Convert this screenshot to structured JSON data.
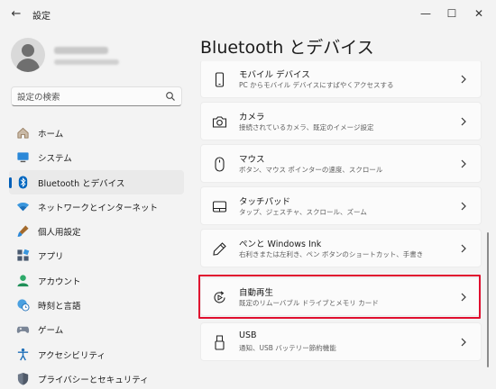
{
  "window": {
    "title": "設定",
    "back_glyph": "←",
    "minimize_glyph": "—",
    "maximize_glyph": "☐",
    "close_glyph": "✕"
  },
  "search": {
    "placeholder": "設定の検索"
  },
  "nav": {
    "items": [
      {
        "label": "ホーム",
        "icon": "home-icon"
      },
      {
        "label": "システム",
        "icon": "monitor-icon"
      },
      {
        "label": "Bluetooth とデバイス",
        "icon": "bluetooth-icon",
        "active": true
      },
      {
        "label": "ネットワークとインターネット",
        "icon": "wifi-icon"
      },
      {
        "label": "個人用設定",
        "icon": "brush-icon"
      },
      {
        "label": "アプリ",
        "icon": "apps-icon"
      },
      {
        "label": "アカウント",
        "icon": "person-icon"
      },
      {
        "label": "時刻と言語",
        "icon": "globe-clock-icon"
      },
      {
        "label": "ゲーム",
        "icon": "gamepad-icon"
      },
      {
        "label": "アクセシビリティ",
        "icon": "accessibility-icon"
      },
      {
        "label": "プライバシーとセキュリティ",
        "icon": "shield-icon"
      }
    ]
  },
  "main": {
    "title": "Bluetooth とデバイス",
    "cards": [
      {
        "title": "モバイル デバイス",
        "desc": "PC からモバイル デバイスにすばやくアクセスする",
        "icon": "phone-icon"
      },
      {
        "title": "カメラ",
        "desc": "接続されているカメラ、既定のイメージ設定",
        "icon": "camera-icon"
      },
      {
        "title": "マウス",
        "desc": "ボタン、マウス ポインターの速度、スクロール",
        "icon": "mouse-icon"
      },
      {
        "title": "タッチパッド",
        "desc": "タップ、ジェスチャ、スクロール、ズーム",
        "icon": "touchpad-icon"
      },
      {
        "title": "ペンと Windows Ink",
        "desc": "右利きまたは左利き、ペン ボタンのショートカット、手書き",
        "icon": "pen-icon"
      },
      {
        "title": "自動再生",
        "desc": "既定のリムーバブル ドライブとメモリ カード",
        "icon": "autoplay-icon",
        "highlighted": true
      },
      {
        "title": "USB",
        "desc": "通知、USB バッテリー節約機能",
        "icon": "usb-icon"
      }
    ]
  },
  "colors": {
    "accent": "#005fb8",
    "highlight": "#e0102f"
  }
}
